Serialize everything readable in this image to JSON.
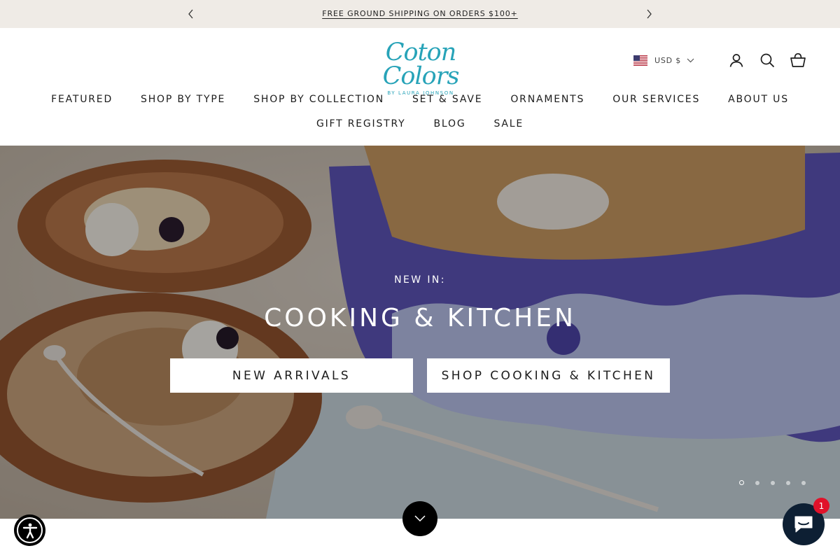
{
  "announcement": {
    "text": "FREE GROUND SHIPPING ON ORDERS $100+"
  },
  "brand": {
    "name": "Coton Colors",
    "tagline": "BY LAURA JOHNSON",
    "color": "#27a3b8"
  },
  "header": {
    "currency": "USD $"
  },
  "nav": {
    "row1": [
      "FEATURED",
      "SHOP BY TYPE",
      "SHOP BY COLLECTION",
      "SET & SAVE",
      "ORNAMENTS",
      "OUR SERVICES",
      "ABOUT US"
    ],
    "row2": [
      "GIFT REGISTRY",
      "BLOG",
      "SALE"
    ]
  },
  "hero": {
    "eyebrow": "NEW IN:",
    "title": "COOKING & KITCHEN",
    "button_primary": "NEW ARRIVALS",
    "button_secondary": "SHOP COOKING & KITCHEN",
    "slide_count": 5,
    "active_slide": 1
  },
  "chat": {
    "badge_count": "1"
  },
  "icons": [
    "chevron-left-icon",
    "chevron-right-icon",
    "us-flag-icon",
    "chevron-down-icon",
    "account-icon",
    "search-icon",
    "cart-icon",
    "accessibility-icon",
    "chat-icon"
  ]
}
